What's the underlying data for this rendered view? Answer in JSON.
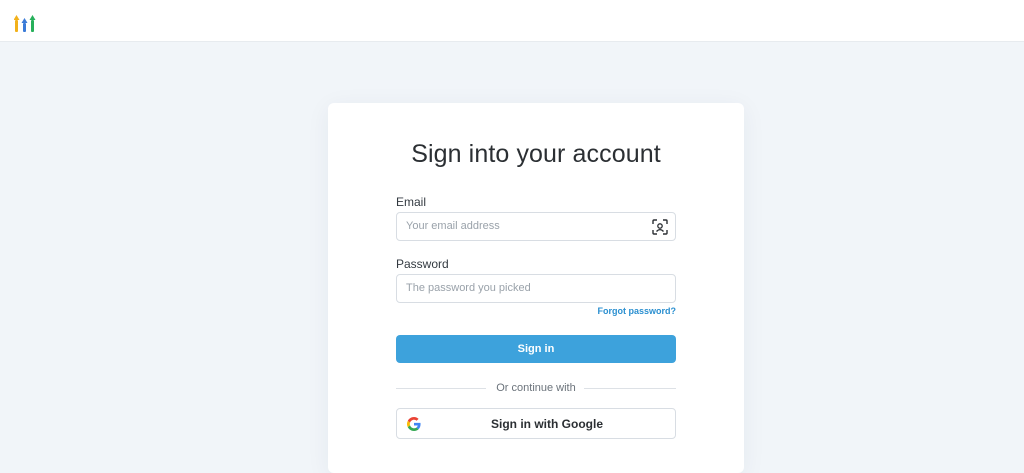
{
  "header": {
    "logo_icon": "gofundme-logo-icon"
  },
  "signin_form": {
    "title": "Sign into your account",
    "email_label": "Email",
    "email_placeholder": "Your email address",
    "email_icon": "scan-icon",
    "password_label": "Password",
    "password_placeholder": "The password you picked",
    "forgot_password": "Forgot password?",
    "submit_label": "Sign in",
    "divider_text": "Or continue with",
    "google_label": "Sign in with Google",
    "google_icon": "google-icon"
  },
  "colors": {
    "page_background": "#f1f5f9",
    "primary_button": "#3da2dc",
    "link": "#2a8fd0"
  }
}
